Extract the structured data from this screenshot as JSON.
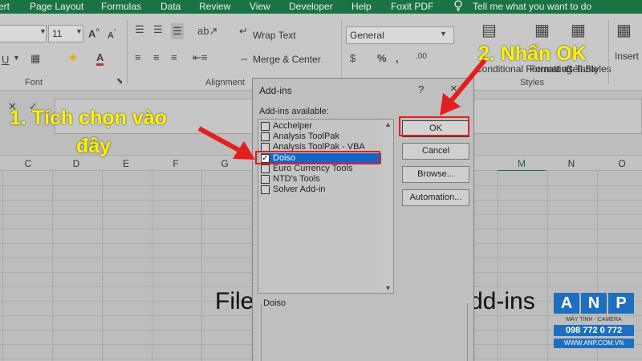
{
  "ribbon_tabs": [
    "ert",
    "Page Layout",
    "Formulas",
    "Data",
    "Review",
    "View",
    "Developer",
    "Help",
    "Foxit PDF",
    "Tell me what you want to do"
  ],
  "ribbon": {
    "font_size": "11",
    "wrap_text": "Wrap Text",
    "merge_center": "Merge & Center",
    "number_format": "General",
    "insert": "Insert",
    "conditional_formatting": "Conditional Formatting",
    "format_as_table": "Format as Table",
    "cell_styles": "Cell Styles",
    "group_font": "Font",
    "group_alignment": "Alignment",
    "group_styles": "Styles"
  },
  "columns": [
    "C",
    "D",
    "E",
    "F",
    "G",
    "",
    "",
    "",
    "",
    "",
    "M",
    "N",
    "O"
  ],
  "selected_column": "M",
  "sheet_text_left": "File",
  "sheet_text_right": "dd-ins",
  "dialog": {
    "title": "Add-ins",
    "help": "?",
    "close": "×",
    "available_label": "Add-ins available:",
    "items": [
      {
        "label": "Acchelper",
        "checked": false
      },
      {
        "label": "Analysis ToolPak",
        "checked": false
      },
      {
        "label": "Analysis ToolPak - VBA",
        "checked": false
      },
      {
        "label": "Doiso",
        "checked": true
      },
      {
        "label": "Euro Currency Tools",
        "checked": false
      },
      {
        "label": "NTD's Tools",
        "checked": false
      },
      {
        "label": "Solver Add-in",
        "checked": false
      }
    ],
    "buttons": {
      "ok": "OK",
      "cancel": "Cancel",
      "browse": "Browse...",
      "automation": "Automation..."
    },
    "description_label": "Doiso"
  },
  "annotations": {
    "step1": "1. Tích chọn vào",
    "step1b": "đây",
    "step2": "2. Nhấn OK",
    "color": "#fff200",
    "arrow_color": "#e41e1e"
  },
  "watermark": {
    "letters": [
      "A",
      "N",
      "P"
    ],
    "subtitle": "MÁY TÍNH - CAMERA",
    "phone": "098 772 0 772",
    "url": "WWW.ANP.COM.VN",
    "color": "#1f6fbf"
  }
}
